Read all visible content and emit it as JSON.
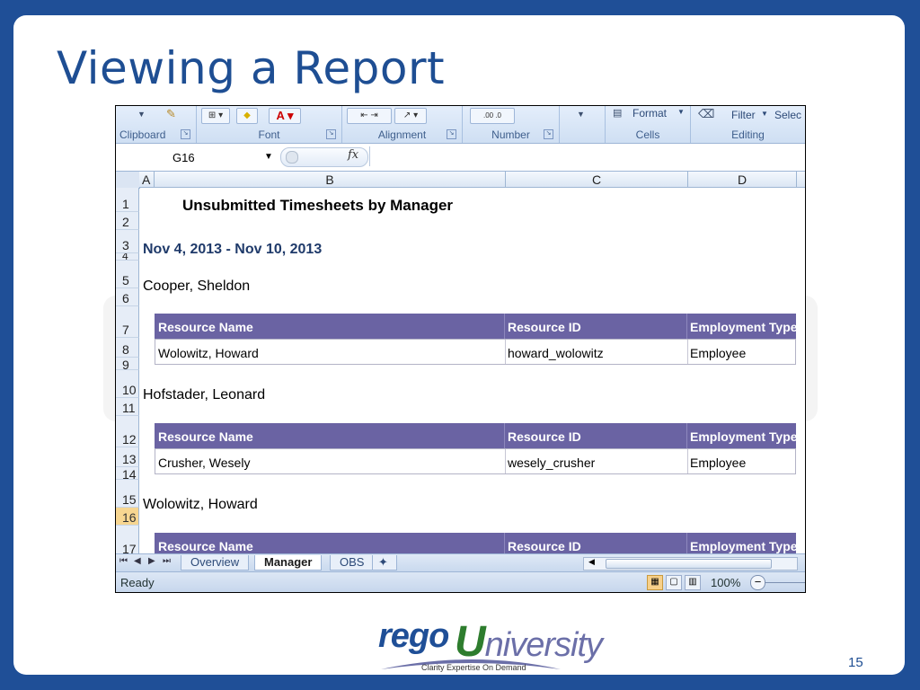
{
  "slide": {
    "title": "Viewing a Report",
    "page_number": "15"
  },
  "ribbon": {
    "groups": [
      "Clipboard",
      "Font",
      "Alignment",
      "Number",
      "Cells",
      "Editing"
    ],
    "format_label": "Format",
    "filter_label": "Filter",
    "select_label": "Selec"
  },
  "formula_bar": {
    "name_box": "G16",
    "fx_label": "fx",
    "value": ""
  },
  "columns": [
    "A",
    "B",
    "C",
    "D"
  ],
  "rows": [
    "1",
    "2",
    "3",
    "4",
    "5",
    "6",
    "7",
    "8",
    "9",
    "10",
    "11",
    "12",
    "13",
    "14",
    "15",
    "16",
    "17"
  ],
  "selected_row": "16",
  "report": {
    "title": "Unsubmitted Timesheets by Manager",
    "date_range": "Nov 4, 2013 - Nov 10, 2013",
    "headers": [
      "Resource Name",
      "Resource ID",
      "Employment Type"
    ],
    "managers": [
      {
        "name": "Cooper, Sheldon",
        "rows": [
          [
            "Wolowitz, Howard",
            "howard_wolowitz",
            "Employee"
          ]
        ]
      },
      {
        "name": "Hofstader, Leonard",
        "rows": [
          [
            "Crusher, Wesely",
            "wesely_crusher",
            "Employee"
          ]
        ]
      },
      {
        "name": "Wolowitz, Howard",
        "rows": []
      }
    ]
  },
  "sheet_tabs": [
    {
      "label": "Overview",
      "active": false
    },
    {
      "label": "Manager",
      "active": true
    },
    {
      "label": "OBS",
      "active": false
    }
  ],
  "status": {
    "ready": "Ready",
    "zoom": "100%"
  },
  "logo": {
    "part1": "rego",
    "part2_U": "U",
    "part2_rest": "niversity",
    "tagline": "Clarity Expertise On Demand"
  }
}
